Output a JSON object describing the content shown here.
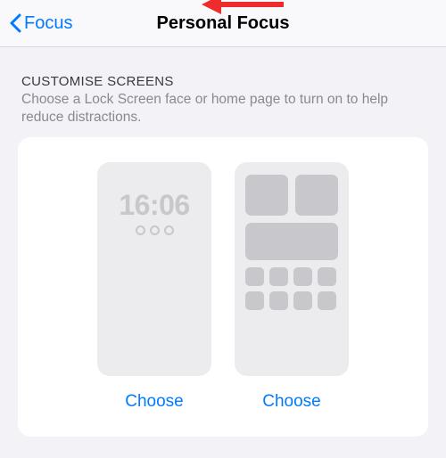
{
  "nav": {
    "back_label": "Focus",
    "title": "Personal Focus"
  },
  "section": {
    "header": "CUSTOMISE SCREENS",
    "description": "Choose a Lock Screen face or home page to turn on to help reduce distractions."
  },
  "lock_screen": {
    "time": "16:06",
    "choose_label": "Choose"
  },
  "home_screen": {
    "choose_label": "Choose"
  },
  "annotation": {
    "type": "arrow",
    "color": "#ee2c2c"
  }
}
